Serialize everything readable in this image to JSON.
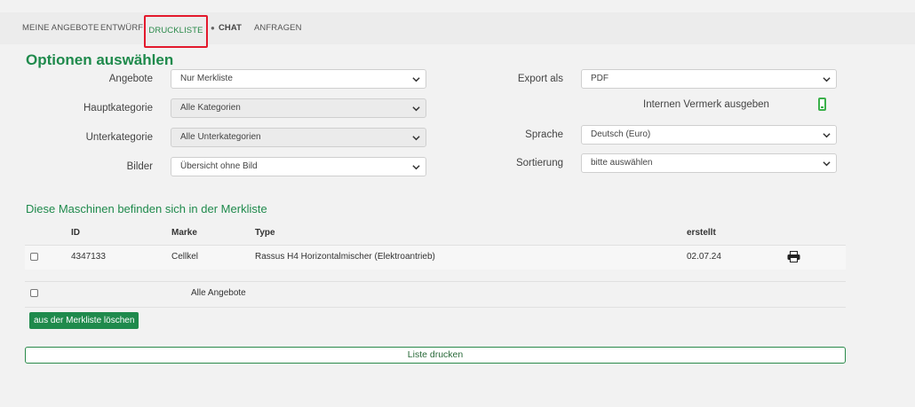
{
  "nav": {
    "items": [
      {
        "label": "MEINE ANGEBOTE"
      },
      {
        "label": "ENTWÜRFE"
      },
      {
        "label": "DRUCKLISTE"
      },
      {
        "label": "CHAT"
      },
      {
        "label": "ANFRAGEN"
      }
    ],
    "active": "DRUCKLISTE"
  },
  "options": {
    "title": "Optionen auswählen",
    "angebote": {
      "label": "Angebote",
      "value": "Nur Merkliste"
    },
    "hauptkategorie": {
      "label": "Hauptkategorie",
      "value": "Alle Kategorien"
    },
    "unterkategorie": {
      "label": "Unterkategorie",
      "value": "Alle Unterkategorien"
    },
    "bilder": {
      "label": "Bilder",
      "value": "Übersicht ohne Bild"
    },
    "export": {
      "label": "Export als",
      "value": "PDF"
    },
    "vermerk_label": "Internen Vermerk ausgeben",
    "sprache": {
      "label": "Sprache",
      "value": "Deutsch (Euro)"
    },
    "sortierung": {
      "label": "Sortierung",
      "value": "bitte auswählen"
    }
  },
  "merkliste": {
    "title": "Diese Maschinen befinden sich in der Merkliste",
    "columns": {
      "id": "ID",
      "marke": "Marke",
      "type": "Type",
      "erstellt": "erstellt"
    },
    "rows": [
      {
        "id": "4347133",
        "marke": "Cellkel",
        "type": "Rassus H4 Horizontalmischer (Elektroantrieb)",
        "erstellt": "02.07.24"
      }
    ],
    "all_label": "Alle Angebote",
    "delete_label": "aus der Merkliste löschen",
    "print_label": "Liste drucken"
  },
  "colors": {
    "accent": "#1f8a4c",
    "highlight": "#e3192c",
    "toggle": "#3bb04a"
  }
}
